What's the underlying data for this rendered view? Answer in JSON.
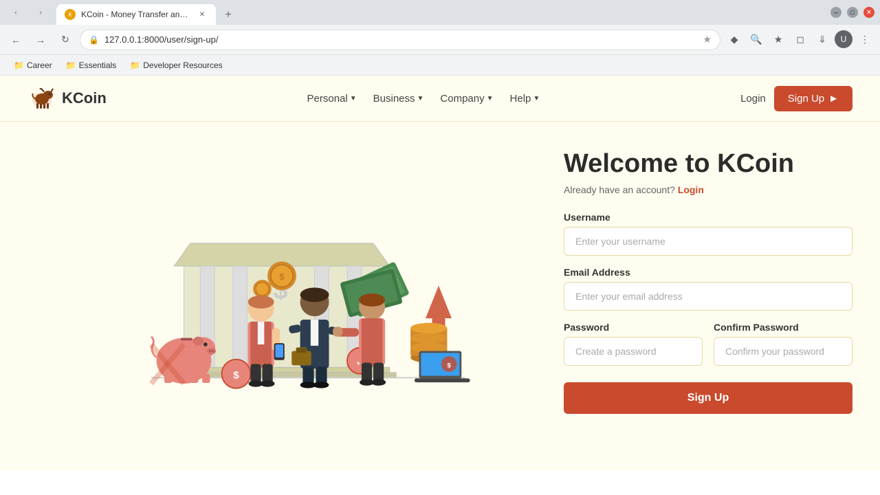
{
  "browser": {
    "tab_title": "KCoin - Money Transfer and O...",
    "address": "127.0.0.1:8000/user/sign-up/",
    "new_tab_label": "+",
    "bookmarks": [
      {
        "label": "Career",
        "type": "folder"
      },
      {
        "label": "Essentials",
        "type": "folder"
      },
      {
        "label": "Developer Resources",
        "type": "folder"
      }
    ]
  },
  "navbar": {
    "logo_text": "KCoin",
    "links": [
      {
        "label": "Personal",
        "has_dropdown": true
      },
      {
        "label": "Business",
        "has_dropdown": true
      },
      {
        "label": "Company",
        "has_dropdown": true
      },
      {
        "label": "Help",
        "has_dropdown": true
      }
    ],
    "login_label": "Login",
    "signup_label": "Sign Up"
  },
  "form": {
    "title": "Welcome to KCoin",
    "subtitle": "Already have an account?",
    "login_link": "Login",
    "username_label": "Username",
    "username_placeholder": "Enter your username",
    "email_label": "Email Address",
    "email_placeholder": "Enter your email address",
    "password_label": "Password",
    "password_placeholder": "Create a password",
    "confirm_password_label": "Confirm Password",
    "confirm_password_placeholder": "Confirm your password",
    "submit_label": "Sign Up"
  },
  "colors": {
    "primary": "#c94a2d",
    "accent": "#e8d8a0",
    "bg": "#fffdf0"
  }
}
